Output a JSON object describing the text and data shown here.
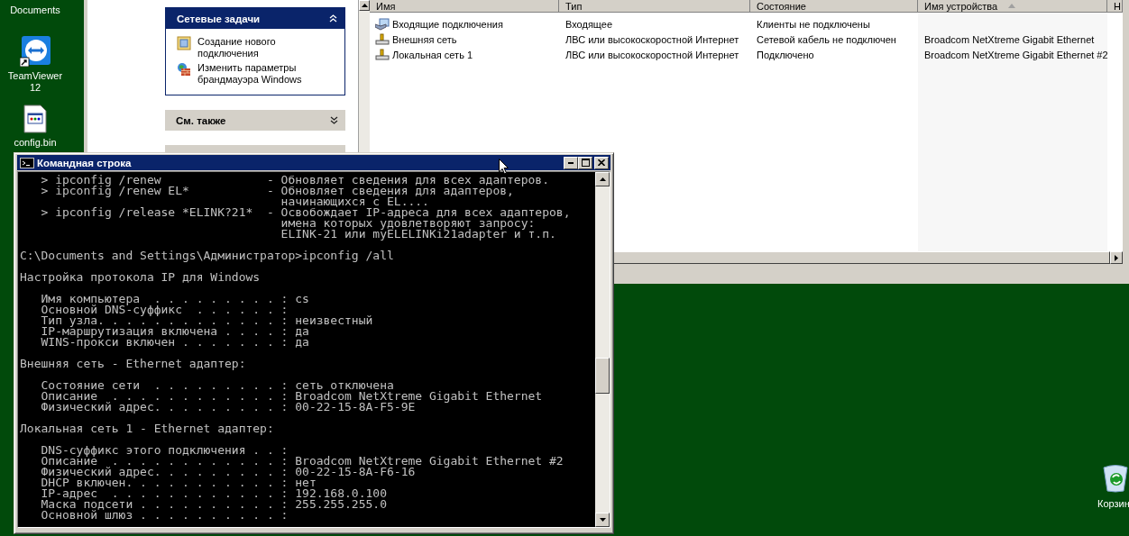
{
  "desktop": {
    "cut_label": "Documents",
    "icons": [
      {
        "kind": "remote",
        "label": "TeamViewer 12"
      },
      {
        "kind": "file",
        "label": "config.bin"
      }
    ],
    "recycle_bin": {
      "label": "Корзин"
    }
  },
  "explorer": {
    "tasks_panel": {
      "title": "Сетевые задачи",
      "expanded": true,
      "items": [
        {
          "kind": "new-connection",
          "label": "Создание нового подключения"
        },
        {
          "kind": "firewall",
          "label": "Изменить параметры брандмауэра Windows"
        }
      ]
    },
    "see_also": {
      "title": "См. также",
      "expanded": false
    },
    "columns": [
      {
        "label": "Имя",
        "sorted": false
      },
      {
        "label": "Тип",
        "sorted": false
      },
      {
        "label": "Состояние",
        "sorted": false
      },
      {
        "label": "Имя устройства",
        "sorted": true
      },
      {
        "label": "Н",
        "sorted": false
      }
    ],
    "rows": [
      {
        "kind": "incoming",
        "name": "Входящие подключения",
        "type": "Входящее",
        "status": "Клиенты не подключены"
      },
      {
        "kind": "lan",
        "name": "Внешняя сеть",
        "type": "ЛВС или высокоскоростной Интернет",
        "status": "Сетевой кабель не подключен",
        "device": "Broadcom NetXtreme Gigabit Ethernet"
      },
      {
        "kind": "lan",
        "name": "Локальная сеть 1",
        "type": "ЛВС или высокоскоростной Интернет",
        "status": "Подключено",
        "device": "Broadcom NetXtreme Gigabit Ethernet #2"
      }
    ]
  },
  "console": {
    "title": "Командная строка",
    "blocks": [
      [
        "   > ipconfig /renew               - Обновляет сведения для всех адаптеров.",
        "   > ipconfig /renew EL*           - Обновляет сведения для адаптеров,",
        "                                     начинающихся с EL....",
        "   > ipconfig /release *ELINK?21*  - Освобождает IP-адреса для всех адаптеров,",
        "                                     имена которых удовлетворяют запросу:",
        "                                     ELINK-21 или myELELINKi21adapter и т.п."
      ],
      [
        "C:\\Documents and Settings\\Администратор>ipconfig /all"
      ],
      [
        "Настройка протокола IP для Windows"
      ],
      [
        "   Имя компьютера  . . . . . . . . . : cs",
        "   Основной DNS-суффикс  . . . . . . :",
        "   Тип узла. . . . . . . . . . . . . : неизвестный",
        "   IP-маршрутизация включена . . . . : да",
        "   WINS-прокси включен . . . . . . . : да"
      ],
      [
        "Внешняя сеть - Ethernet адаптер:"
      ],
      [
        "   Состояние сети  . . . . . . . . . : сеть отключена",
        "   Описание  . . . . . . . . . . . . : Broadcom NetXtreme Gigabit Ethernet",
        "   Физический адрес. . . . . . . . . : 00-22-15-8A-F5-9E"
      ],
      [
        "Локальная сеть 1 - Ethernet адаптер:"
      ],
      [
        "   DNS-суффикс этого подключения . . :",
        "   Описание  . . . . . . . . . . . . : Broadcom NetXtreme Gigabit Ethernet #2",
        "   Физический адрес. . . . . . . . . : 00-22-15-8A-F6-16",
        "   DHCP включен. . . . . . . . . . . : нет",
        "   IP-адрес  . . . . . . . . . . . . : 192.168.0.100",
        "   Маска подсети . . . . . . . . . . : 255.255.255.0",
        "   Основной шлюз . . . . . . . . . . :"
      ]
    ]
  }
}
